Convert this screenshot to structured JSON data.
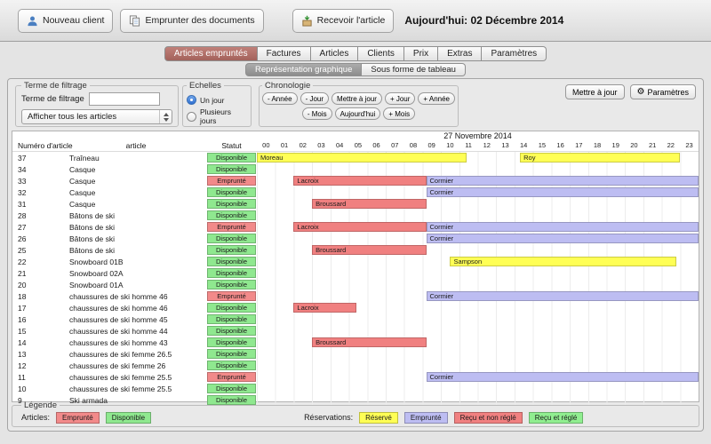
{
  "toolbar": {
    "buttons": [
      {
        "label": "Nouveau client",
        "icon": "user-icon"
      },
      {
        "label": "Emprunter des documents",
        "icon": "documents-icon"
      },
      {
        "label": "Recevoir l'article",
        "icon": "receive-box-icon"
      }
    ],
    "today_label": "Aujourd'hui: 02 Décembre 2014"
  },
  "tabs": {
    "main": [
      {
        "label": "Articles empruntés",
        "selected": true
      },
      {
        "label": "Factures",
        "selected": false
      },
      {
        "label": "Articles",
        "selected": false
      },
      {
        "label": "Clients",
        "selected": false
      },
      {
        "label": "Prix",
        "selected": false
      },
      {
        "label": "Extras",
        "selected": false
      },
      {
        "label": "Paramètres",
        "selected": false
      }
    ],
    "sub": [
      {
        "label": "Représentation graphique",
        "selected": true
      },
      {
        "label": "Sous forme de tableau",
        "selected": false
      }
    ]
  },
  "filters": {
    "group_title": "Terme de filtrage",
    "input_label": "Terme de filtrage",
    "input_value": "",
    "dropdown_value": "Afficher tous les articles"
  },
  "echelles": {
    "group_title": "Echelles",
    "options": [
      {
        "label": "Un jour",
        "selected": true
      },
      {
        "label": "Plusieurs jours",
        "selected": false
      }
    ]
  },
  "chronologie": {
    "group_title": "Chronologie",
    "row1": [
      "- Année",
      "- Jour",
      "Mettre à jour",
      "+ Jour",
      "+ Année"
    ],
    "row2": [
      "- Mois",
      "Aujourd'hui",
      "+ Mois"
    ]
  },
  "actions": {
    "update_label": "Mettre à jour",
    "settings_label": "Paramètres",
    "settings_icon": "gear-icon"
  },
  "chart": {
    "date_header": "27 Novembre 2014",
    "columns": [
      "Numéro d'article",
      "article",
      "Statut"
    ],
    "hours": [
      "00",
      "01",
      "02",
      "03",
      "04",
      "05",
      "06",
      "07",
      "08",
      "09",
      "10",
      "11",
      "12",
      "13",
      "14",
      "15",
      "16",
      "17",
      "18",
      "19",
      "20",
      "21",
      "22",
      "23"
    ],
    "rows": [
      {
        "num": "37",
        "article": "Traîneau",
        "status": "Disponible",
        "bars": [
          {
            "label": "Moreau",
            "start": 0,
            "end": 11.4,
            "type": "reserve"
          },
          {
            "label": "Roy",
            "start": 14.3,
            "end": 23,
            "type": "reserve"
          }
        ]
      },
      {
        "num": "34",
        "article": "Casque",
        "status": "Disponible",
        "bars": []
      },
      {
        "num": "33",
        "article": "Casque",
        "status": "Emprunté",
        "bars": [
          {
            "label": "Lacroix",
            "start": 2,
            "end": 9.2,
            "type": "received_unpaid"
          },
          {
            "label": "Cormier",
            "start": 9.2,
            "end": 24,
            "type": "borrowed"
          }
        ]
      },
      {
        "num": "32",
        "article": "Casque",
        "status": "Disponible",
        "bars": [
          {
            "label": "Cormier",
            "start": 9.2,
            "end": 24,
            "type": "borrowed"
          }
        ]
      },
      {
        "num": "31",
        "article": "Casque",
        "status": "Disponible",
        "bars": [
          {
            "label": "Broussard",
            "start": 3,
            "end": 9.2,
            "type": "received_unpaid"
          }
        ]
      },
      {
        "num": "28",
        "article": "Bâtons de ski",
        "status": "Disponible",
        "bars": []
      },
      {
        "num": "27",
        "article": "Bâtons de ski",
        "status": "Emprunté",
        "bars": [
          {
            "label": "Lacroix",
            "start": 2,
            "end": 9.2,
            "type": "received_unpaid"
          },
          {
            "label": "Cormier",
            "start": 9.2,
            "end": 24,
            "type": "borrowed"
          }
        ]
      },
      {
        "num": "26",
        "article": "Bâtons de ski",
        "status": "Disponible",
        "bars": [
          {
            "label": "Cormier",
            "start": 9.2,
            "end": 24,
            "type": "borrowed"
          }
        ]
      },
      {
        "num": "25",
        "article": "Bâtons de ski",
        "status": "Disponible",
        "bars": [
          {
            "label": "Broussard",
            "start": 3,
            "end": 9.2,
            "type": "received_unpaid"
          }
        ]
      },
      {
        "num": "22",
        "article": "Snowboard 01B",
        "status": "Disponible",
        "bars": [
          {
            "label": "Sampson",
            "start": 10.5,
            "end": 22.8,
            "type": "reserve"
          }
        ]
      },
      {
        "num": "21",
        "article": "Snowboard 02A",
        "status": "Disponible",
        "bars": []
      },
      {
        "num": "20",
        "article": "Snowboard 01A",
        "status": "Disponible",
        "bars": []
      },
      {
        "num": "18",
        "article": "chaussures de ski homme 46",
        "status": "Emprunté",
        "bars": [
          {
            "label": "Cormier",
            "start": 9.2,
            "end": 24,
            "type": "borrowed"
          }
        ]
      },
      {
        "num": "17",
        "article": "chaussures de ski homme 46",
        "status": "Disponible",
        "bars": [
          {
            "label": "Lacroix",
            "start": 2,
            "end": 5.4,
            "type": "received_unpaid"
          }
        ]
      },
      {
        "num": "16",
        "article": "chaussures de ski homme 45",
        "status": "Disponible",
        "bars": []
      },
      {
        "num": "15",
        "article": "chaussures de ski homme 44",
        "status": "Disponible",
        "bars": []
      },
      {
        "num": "14",
        "article": "chaussures de ski homme 43",
        "status": "Disponible",
        "bars": [
          {
            "label": "Broussard",
            "start": 3,
            "end": 9.2,
            "type": "received_unpaid"
          }
        ]
      },
      {
        "num": "13",
        "article": "chaussures de ski femme 26.5",
        "status": "Disponible",
        "bars": []
      },
      {
        "num": "12",
        "article": "chaussures de ski femme 26",
        "status": "Disponible",
        "bars": []
      },
      {
        "num": "11",
        "article": "chaussures de ski femme 25.5",
        "status": "Emprunté",
        "bars": [
          {
            "label": "Cormier",
            "start": 9.2,
            "end": 24,
            "type": "borrowed"
          }
        ]
      },
      {
        "num": "10",
        "article": "chaussures de ski femme 25.5",
        "status": "Disponible",
        "bars": []
      },
      {
        "num": "9",
        "article": "Ski armada",
        "status": "Disponible",
        "bars": []
      }
    ]
  },
  "legend": {
    "title": "Légende",
    "groups": [
      {
        "label": "Articles:",
        "items": [
          {
            "label": "Emprunté",
            "color": "#f28a8a"
          },
          {
            "label": "Disponible",
            "color": "#8fe88f"
          }
        ]
      },
      {
        "label": "Réservations:",
        "items": [
          {
            "label": "Réservé",
            "color": "#ffff55"
          },
          {
            "label": "Emprunté",
            "color": "#bdbdf2"
          },
          {
            "label": "Reçu et non réglé",
            "color": "#f08080"
          },
          {
            "label": "Reçu et réglé",
            "color": "#90ee90"
          }
        ]
      }
    ]
  },
  "colors": {
    "status": {
      "Disponible": "#8fe88f",
      "Emprunté": "#f28a8a"
    },
    "reservations": {
      "reserve": "#ffff55",
      "borrowed": "#bdbdf2",
      "received_unpaid": "#f08080",
      "received_paid": "#90ee90"
    },
    "selected_tab": "#a3625b"
  }
}
